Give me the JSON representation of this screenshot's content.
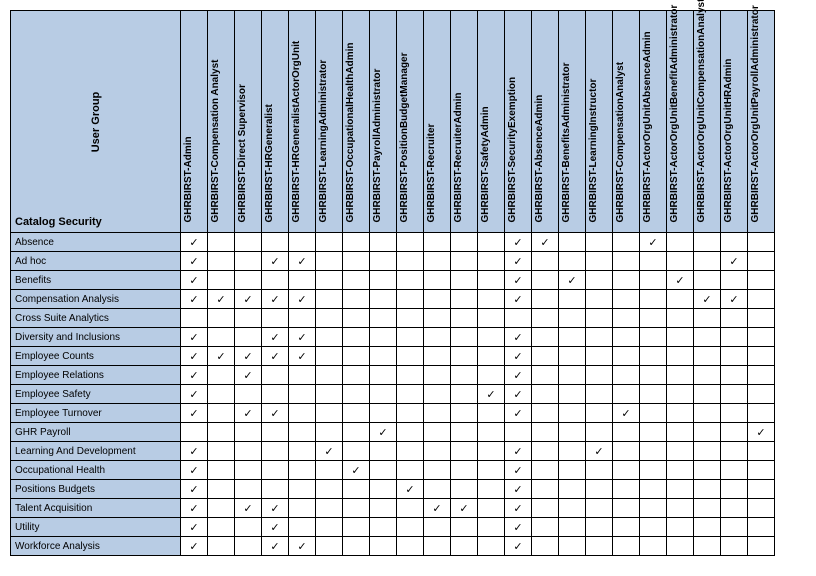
{
  "corner": {
    "top_label": "User Group",
    "bottom_label": "Catalog Security"
  },
  "columns": [
    "GHRBIRST-Admin",
    "GHRBIRST-Compensation Analyst",
    "GHRBIRST-Direct Supervisor",
    "GHRBIRST-HRGeneralist",
    "GHRBIRST-HRGeneralistActorOrgUnit",
    "GHRBIRST-LearningAdministrator",
    "GHRBIRST-OccupationalHealthAdmin",
    "GHRBIRST-PayrollAdministrator",
    "GHRBIRST-PositionBudgetManager",
    "GHRBIRST-Recruiter",
    "GHRBIRST-RecruiterAdmin",
    "GHRBIRST-SafetyAdmin",
    "GHRBIRST-SecurityExemption",
    "GHRBIRST-AbsenceAdmin",
    "GHRBIRST-BenefitsAdministrator",
    "GHRBIRST-LearningInstructor",
    "GHRBIRST-CompensationAnalyst",
    "GHRBIRST-ActorOrgUnitAbsenceAdmin",
    "GHRBIRST-ActorOrgUnitBenefitAdministrator",
    "GHRBIRST-ActorOrgUnitCompensationAnalyst",
    "GHRBIRST-ActorOrgUnitHRAdmin",
    "GHRBIRST-ActorOrgUnitPayrollAdministrator"
  ],
  "rows": [
    {
      "label": "Absence",
      "checks": [
        1,
        0,
        0,
        0,
        0,
        0,
        0,
        0,
        0,
        0,
        0,
        0,
        1,
        1,
        0,
        0,
        0,
        1,
        0,
        0,
        0,
        0
      ]
    },
    {
      "label": "Ad hoc",
      "checks": [
        1,
        0,
        0,
        1,
        1,
        0,
        0,
        0,
        0,
        0,
        0,
        0,
        1,
        0,
        0,
        0,
        0,
        0,
        0,
        0,
        1,
        0
      ]
    },
    {
      "label": "Benefits",
      "checks": [
        1,
        0,
        0,
        0,
        0,
        0,
        0,
        0,
        0,
        0,
        0,
        0,
        1,
        0,
        1,
        0,
        0,
        0,
        1,
        0,
        0,
        0
      ]
    },
    {
      "label": "Compensation Analysis",
      "checks": [
        1,
        1,
        1,
        1,
        1,
        0,
        0,
        0,
        0,
        0,
        0,
        0,
        1,
        0,
        0,
        0,
        0,
        0,
        0,
        1,
        1,
        0
      ]
    },
    {
      "label": "Cross Suite Analytics",
      "checks": [
        0,
        0,
        0,
        0,
        0,
        0,
        0,
        0,
        0,
        0,
        0,
        0,
        0,
        0,
        0,
        0,
        0,
        0,
        0,
        0,
        0,
        0
      ]
    },
    {
      "label": "Diversity and Inclusions",
      "checks": [
        1,
        0,
        0,
        1,
        1,
        0,
        0,
        0,
        0,
        0,
        0,
        0,
        1,
        0,
        0,
        0,
        0,
        0,
        0,
        0,
        0,
        0
      ]
    },
    {
      "label": "Employee Counts",
      "checks": [
        1,
        1,
        1,
        1,
        1,
        0,
        0,
        0,
        0,
        0,
        0,
        0,
        1,
        0,
        0,
        0,
        0,
        0,
        0,
        0,
        0,
        0
      ]
    },
    {
      "label": "Employee Relations",
      "checks": [
        1,
        0,
        1,
        0,
        0,
        0,
        0,
        0,
        0,
        0,
        0,
        0,
        1,
        0,
        0,
        0,
        0,
        0,
        0,
        0,
        0,
        0
      ]
    },
    {
      "label": "Employee Safety",
      "checks": [
        1,
        0,
        0,
        0,
        0,
        0,
        0,
        0,
        0,
        0,
        0,
        1,
        1,
        0,
        0,
        0,
        0,
        0,
        0,
        0,
        0,
        0
      ]
    },
    {
      "label": "Employee Turnover",
      "checks": [
        1,
        0,
        1,
        1,
        0,
        0,
        0,
        0,
        0,
        0,
        0,
        0,
        1,
        0,
        0,
        0,
        1,
        0,
        0,
        0,
        0,
        0
      ]
    },
    {
      "label": "GHR Payroll",
      "checks": [
        0,
        0,
        0,
        0,
        0,
        0,
        0,
        1,
        0,
        0,
        0,
        0,
        0,
        0,
        0,
        0,
        0,
        0,
        0,
        0,
        0,
        1
      ]
    },
    {
      "label": "Learning And Development",
      "checks": [
        1,
        0,
        0,
        0,
        0,
        1,
        0,
        0,
        0,
        0,
        0,
        0,
        1,
        0,
        0,
        1,
        0,
        0,
        0,
        0,
        0,
        0
      ]
    },
    {
      "label": "Occupational Health",
      "checks": [
        1,
        0,
        0,
        0,
        0,
        0,
        1,
        0,
        0,
        0,
        0,
        0,
        1,
        0,
        0,
        0,
        0,
        0,
        0,
        0,
        0,
        0
      ]
    },
    {
      "label": "Positions Budgets",
      "checks": [
        1,
        0,
        0,
        0,
        0,
        0,
        0,
        0,
        1,
        0,
        0,
        0,
        1,
        0,
        0,
        0,
        0,
        0,
        0,
        0,
        0,
        0
      ]
    },
    {
      "label": "Talent Acquisition",
      "checks": [
        1,
        0,
        1,
        1,
        0,
        0,
        0,
        0,
        0,
        1,
        1,
        0,
        1,
        0,
        0,
        0,
        0,
        0,
        0,
        0,
        0,
        0
      ]
    },
    {
      "label": "Utility",
      "checks": [
        1,
        0,
        0,
        1,
        0,
        0,
        0,
        0,
        0,
        0,
        0,
        0,
        1,
        0,
        0,
        0,
        0,
        0,
        0,
        0,
        0,
        0
      ]
    },
    {
      "label": "Workforce Analysis",
      "checks": [
        1,
        0,
        0,
        1,
        1,
        0,
        0,
        0,
        0,
        0,
        0,
        0,
        1,
        0,
        0,
        0,
        0,
        0,
        0,
        0,
        0,
        0
      ]
    }
  ],
  "check_mark": "✓"
}
